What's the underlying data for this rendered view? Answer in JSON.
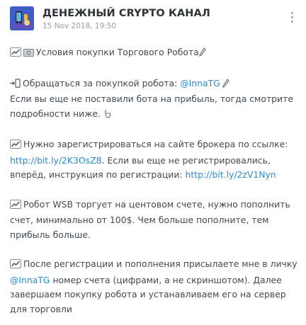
{
  "header": {
    "channel_name": "ДЕНЕЖНЫЙ CRYPTO КАНАЛ",
    "date": "15 Nov 2018, 19:50"
  },
  "icons": {
    "avatar": "channel-avatar",
    "menu": "vertical-ellipsis-icon",
    "chart": "chart-increasing-icon",
    "money": "dollar-banknote-icon",
    "arrow_phone": "arrow-to-phone-icon",
    "pencil": "pencil-icon",
    "point_down": "pointing-down-icon"
  },
  "colors": {
    "link": "#2a8ccf",
    "text": "#44494f",
    "muted": "#9aa0a6"
  },
  "post": {
    "title": "Условия покупки Торгового Робота",
    "p1": {
      "text_a": "Обращаться за покупкой робота: ",
      "handle": "@InnaTG",
      "text_b": "Если вы еще не поставили бота на прибыль, тогда смотрите подробности ниже."
    },
    "p2": {
      "text_a": "Нужно зарегистрироваться на сайте брокера по ссылке: ",
      "link1": "http://bit.ly/2K3OsZ8",
      "text_b": ". Если вы еще не регистрировались, вперёд, инструкция по регистрации: ",
      "link2": "http://bit.ly/2zV1Nyn"
    },
    "p3": {
      "text": "Робот WSB торгует на центовом счете, нужно пополнить счет, минимально от 100$. Чем больше пополните, тем прибыль больше."
    },
    "p4": {
      "text_a": "После регистрации и пополнения присылаете мне в личку ",
      "handle": "@InnaTG",
      "text_b": " номер счета (цифрами, а не скриншотом). Далее завершаем покупку робота и устанавливаем его на сервер для торговли"
    }
  }
}
